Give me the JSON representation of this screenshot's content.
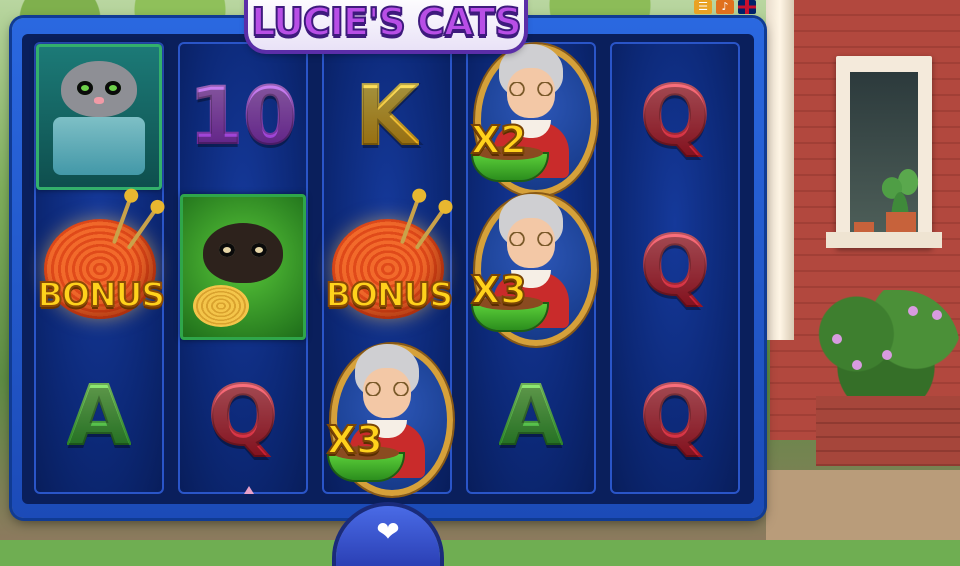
{
  "game": {
    "logo_text": "LUCIE'S CATS"
  },
  "top_icons": [
    "menu-icon",
    "sound-icon",
    "uk-flag-icon"
  ],
  "reels": [
    {
      "symbols": [
        {
          "type": "grey-cat-fishbowl"
        },
        {
          "type": "bonus-yarn",
          "label": "BONUS"
        },
        {
          "type": "card",
          "label": "A",
          "color": "#49c442"
        }
      ]
    },
    {
      "symbols": [
        {
          "type": "card",
          "label": "10",
          "color": "#b152e3"
        },
        {
          "type": "black-cat-yarn"
        },
        {
          "type": "card",
          "label": "Q",
          "color": "#e23a4a"
        }
      ]
    },
    {
      "symbols": [
        {
          "type": "card",
          "label": "K",
          "color": "#f2c21b"
        },
        {
          "type": "bonus-yarn",
          "label": "BONUS"
        },
        {
          "type": "granny",
          "multiplier": "X3"
        }
      ]
    },
    {
      "symbols": [
        {
          "type": "granny",
          "multiplier": "X2"
        },
        {
          "type": "granny",
          "multiplier": "X3"
        },
        {
          "type": "card",
          "label": "A",
          "color": "#49c442"
        }
      ]
    },
    {
      "symbols": [
        {
          "type": "card",
          "label": "Q",
          "color": "#e23a4a"
        },
        {
          "type": "card",
          "label": "Q",
          "color": "#e23a4a"
        },
        {
          "type": "card",
          "label": "Q",
          "color": "#e23a4a"
        }
      ]
    }
  ],
  "spin_button": {
    "icon": "paw-icon"
  }
}
